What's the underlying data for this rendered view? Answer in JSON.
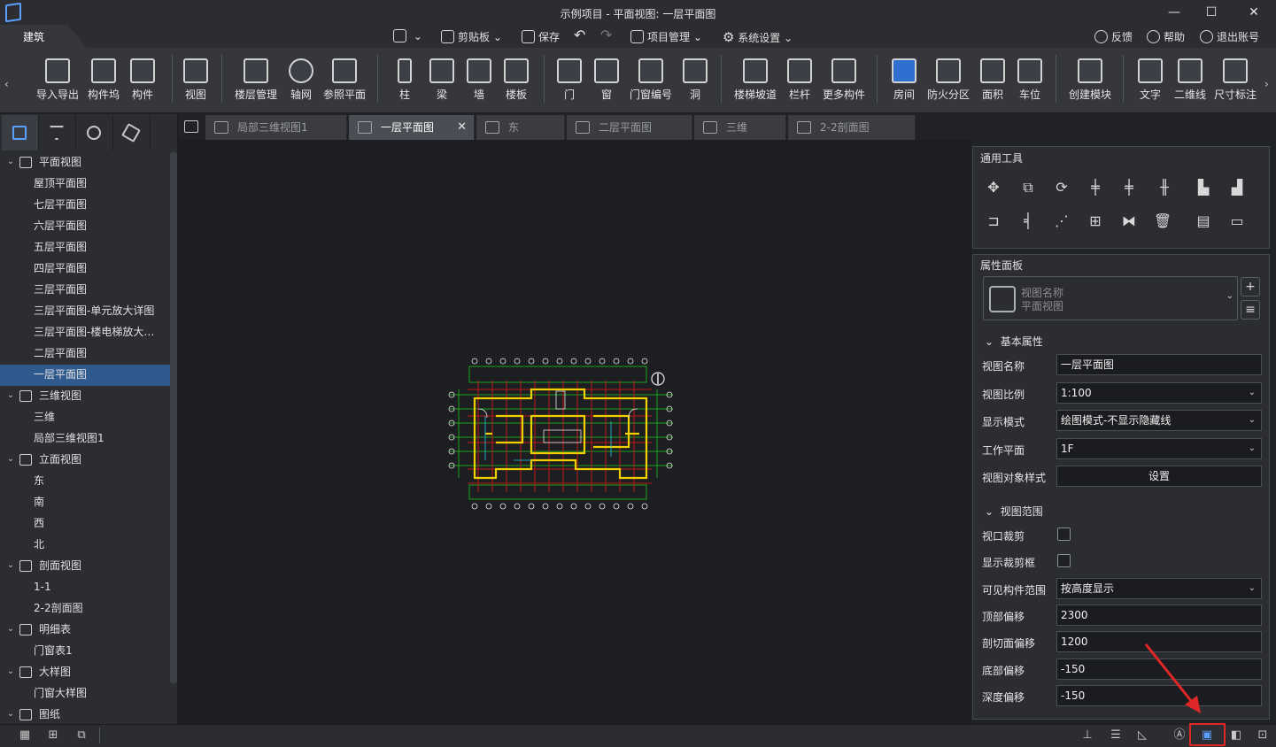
{
  "window": {
    "title": "示例项目 - 平面视图: 一层平面图"
  },
  "menu": {
    "tab": "建筑",
    "items": [
      {
        "label": ""
      },
      {
        "label": "剪贴板"
      },
      {
        "label": "保存"
      },
      {
        "label": ""
      },
      {
        "label": ""
      },
      {
        "label": "项目管理"
      },
      {
        "label": "系统设置"
      }
    ],
    "right": [
      {
        "label": "反馈"
      },
      {
        "label": "帮助"
      },
      {
        "label": "退出账号"
      }
    ]
  },
  "ribbon": {
    "buttons": [
      {
        "label": "导入导出"
      },
      {
        "label": "构件坞"
      },
      {
        "label": "构件"
      },
      {
        "label": "视图"
      },
      {
        "label": "楼层管理"
      },
      {
        "label": "轴网"
      },
      {
        "label": "参照平面"
      },
      {
        "label": "柱"
      },
      {
        "label": "梁"
      },
      {
        "label": "墙"
      },
      {
        "label": "楼板"
      },
      {
        "label": "门"
      },
      {
        "label": "窗"
      },
      {
        "label": "门窗编号"
      },
      {
        "label": "洞"
      },
      {
        "label": "楼梯坡道"
      },
      {
        "label": "栏杆"
      },
      {
        "label": "更多构件"
      },
      {
        "label": "房间"
      },
      {
        "label": "防火分区"
      },
      {
        "label": "面积"
      },
      {
        "label": "车位"
      },
      {
        "label": "创建模块"
      },
      {
        "label": "文字"
      },
      {
        "label": "二维线"
      },
      {
        "label": "尺寸标注"
      }
    ]
  },
  "tree": {
    "nodes": [
      {
        "label": "平面视图",
        "level": 0
      },
      {
        "label": "屋顶平面图",
        "level": 1
      },
      {
        "label": "七层平面图",
        "level": 1
      },
      {
        "label": "六层平面图",
        "level": 1
      },
      {
        "label": "五层平面图",
        "level": 1
      },
      {
        "label": "四层平面图",
        "level": 1
      },
      {
        "label": "三层平面图",
        "level": 1
      },
      {
        "label": "三层平面图-单元放大详图",
        "level": 1
      },
      {
        "label": "三层平面图-楼电梯放大…",
        "level": 1
      },
      {
        "label": "二层平面图",
        "level": 1
      },
      {
        "label": "一层平面图",
        "level": 1,
        "selected": true
      },
      {
        "label": "三维视图",
        "level": 0
      },
      {
        "label": "三维",
        "level": 1
      },
      {
        "label": "局部三维视图1",
        "level": 1
      },
      {
        "label": "立面视图",
        "level": 0
      },
      {
        "label": "东",
        "level": 1
      },
      {
        "label": "南",
        "level": 1
      },
      {
        "label": "西",
        "level": 1
      },
      {
        "label": "北",
        "level": 1
      },
      {
        "label": "剖面视图",
        "level": 0
      },
      {
        "label": "1-1",
        "level": 1
      },
      {
        "label": "2-2剖面图",
        "level": 1
      },
      {
        "label": "明细表",
        "level": 0
      },
      {
        "label": "门窗表1",
        "level": 1
      },
      {
        "label": "大样图",
        "level": 0
      },
      {
        "label": "门窗大样图",
        "level": 1
      },
      {
        "label": "图纸",
        "level": 0
      }
    ]
  },
  "tabs": [
    {
      "label": "局部三维视图1",
      "active": false
    },
    {
      "label": "一层平面图",
      "active": true
    },
    {
      "label": "东",
      "active": false
    },
    {
      "label": "二层平面图",
      "active": false
    },
    {
      "label": "三维",
      "active": false
    },
    {
      "label": "2-2剖面图",
      "active": false
    }
  ],
  "tools_panel": {
    "title": "通用工具"
  },
  "props": {
    "title": "属性面板",
    "type_label": "视图名称",
    "type_value": "平面视图",
    "section_basic": "基本属性",
    "rows_basic": [
      {
        "label": "视图名称",
        "value": "一层平面图",
        "kind": "text"
      },
      {
        "label": "视图比例",
        "value": "1:100",
        "kind": "select"
      },
      {
        "label": "显示模式",
        "value": "绘图模式-不显示隐藏线",
        "kind": "select"
      },
      {
        "label": "工作平面",
        "value": "1F",
        "kind": "select"
      },
      {
        "label": "视图对象样式",
        "value": "设置",
        "kind": "button"
      }
    ],
    "section_range": "视图范围",
    "rows_range": [
      {
        "label": "视口裁剪",
        "value": "",
        "kind": "checkbox"
      },
      {
        "label": "显示裁剪框",
        "value": "",
        "kind": "checkbox"
      },
      {
        "label": "可见构件范围",
        "value": "按高度显示",
        "kind": "select"
      },
      {
        "label": "顶部偏移",
        "value": "2300",
        "kind": "text"
      },
      {
        "label": "剖切面偏移",
        "value": "1200",
        "kind": "text"
      },
      {
        "label": "底部偏移",
        "value": "-150",
        "kind": "text"
      },
      {
        "label": "深度偏移",
        "value": "-150",
        "kind": "text"
      }
    ]
  },
  "colors": {
    "accent": "#5aa0ff",
    "selection": "#2f5a8e",
    "highlight": "#e02626"
  }
}
